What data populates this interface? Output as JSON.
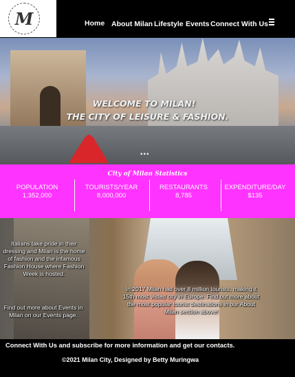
{
  "logo": {
    "letter": "M"
  },
  "nav": {
    "links": [
      "Home",
      "About Milan",
      "Lifestyle",
      "Events",
      "Connect With Us"
    ],
    "menu_icon": "hamburger-icon"
  },
  "hero": {
    "title_line1": "WELCOME TO MILAN!",
    "title_line2": "THE CITY OF LEISURE & FASHION.",
    "slide_dots": "•••"
  },
  "stats": {
    "title": "City of Milan Statistics",
    "items": [
      {
        "label": "POPULATION",
        "value": "1,352,000"
      },
      {
        "label": "TOURISTS/YEAR",
        "value": "8,000,000"
      },
      {
        "label": "RESTAURANTS",
        "value": "8,785"
      },
      {
        "label": "EXPENDITURE/DAY",
        "value": "$135"
      }
    ],
    "background_color": "#ff33ff"
  },
  "lifestyle": {
    "text1": "Italians take pride in their dressing and Milan is the home of fashion and the infamous Fashion House where Fashion Week is hosted.",
    "text2": "Find out more about Events in Milan on our Events page.",
    "text3": "In 2017 Milan had over 8 million tourists, making it 15th most visted city in Europe. Find out more about the most popular tourist destinations in our About Milan section above!"
  },
  "footer": {
    "connect": "Connect With Us and subscribe for more information and get our contacts.",
    "copyright": "©2021 Milan City, Designed by Betty Muringwa"
  }
}
